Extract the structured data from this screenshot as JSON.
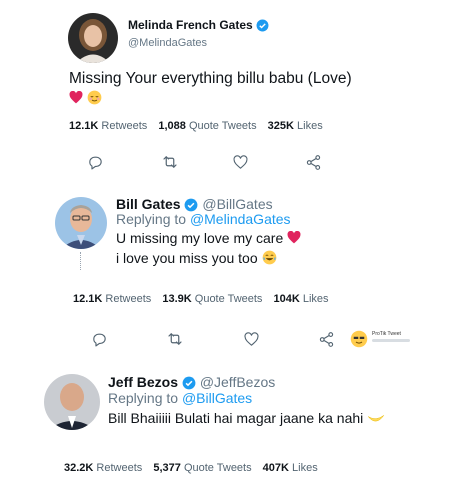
{
  "tweet1": {
    "name": "Melinda French Gates",
    "handle": "@MelindaGates",
    "text": "Missing Your everything billu babu (Love)",
    "stats": {
      "retweets_count": "12.1K",
      "retweets_label": "Retweets",
      "quotes_count": "1,088",
      "quotes_label": "Quote Tweets",
      "likes_count": "325K",
      "likes_label": "Likes"
    }
  },
  "tweet2": {
    "name": "Bill Gates",
    "handle": "@BillGates",
    "replying_prefix": "Replying to",
    "replying_to": "@MelindaGates",
    "line1": "U missing my love my care",
    "line2": "i love you miss you too",
    "stats": {
      "retweets_count": "12.1K",
      "retweets_label": "Retweets",
      "quotes_count": "13.9K",
      "quotes_label": "Quote Tweets",
      "likes_count": "104K",
      "likes_label": "Likes"
    },
    "watermark_title": "ProTik Tweet"
  },
  "tweet3": {
    "name": "Jeff Bezos",
    "handle": "@JeffBezos",
    "replying_prefix": "Replying to",
    "replying_to": "@BillGates",
    "text": "Bill Bhaiiiii Bulati hai magar jaane ka nahi",
    "stats": {
      "retweets_count": "32.2K",
      "retweets_label": "Retweets",
      "quotes_count": "5,377",
      "quotes_label": "Quote Tweets",
      "likes_count": "407K",
      "likes_label": "Likes"
    }
  },
  "colors": {
    "verified": "#1d9bf0",
    "link": "#1d9bf0",
    "icon": "#536471",
    "heart": "#e0245e"
  },
  "icons": [
    "reply-icon",
    "retweet-icon",
    "like-icon",
    "share-icon",
    "verified-icon"
  ]
}
